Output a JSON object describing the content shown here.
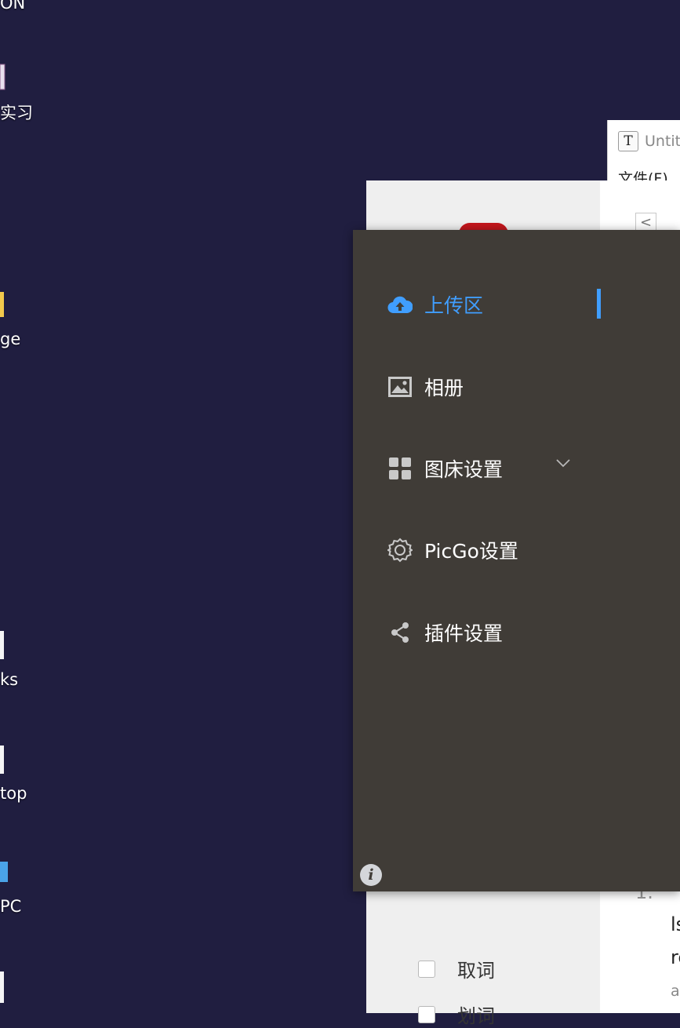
{
  "desktop": {
    "icons": [
      {
        "label": "ON"
      },
      {
        "label": "实习"
      },
      {
        "label": "ge"
      },
      {
        "label": "ks"
      },
      {
        "label": "top"
      },
      {
        "label": "PC"
      }
    ]
  },
  "typora": {
    "icon_letter": "T",
    "title": "Untit",
    "menu_file": "文件(F)"
  },
  "picgo_back": {
    "back_button": "<",
    "checkboxes": [
      {
        "label": "取词"
      },
      {
        "label": "划词"
      }
    ],
    "main_text": {
      "list_marker": "1.",
      "line1": "ls",
      "line2": "re",
      "line3": "a"
    }
  },
  "menu": {
    "items": [
      {
        "label": "上传区",
        "icon": "cloud-upload-icon",
        "active": true
      },
      {
        "label": "相册",
        "icon": "image-icon"
      },
      {
        "label": "图床设置",
        "icon": "grid-icon",
        "has_submenu": true
      },
      {
        "label": "PicGo设置",
        "icon": "gear-icon"
      },
      {
        "label": "插件设置",
        "icon": "share-icon"
      }
    ],
    "info": "i"
  },
  "colors": {
    "desktop_bg": "#201e40",
    "menu_bg": "#403c37",
    "accent": "#409eff"
  }
}
